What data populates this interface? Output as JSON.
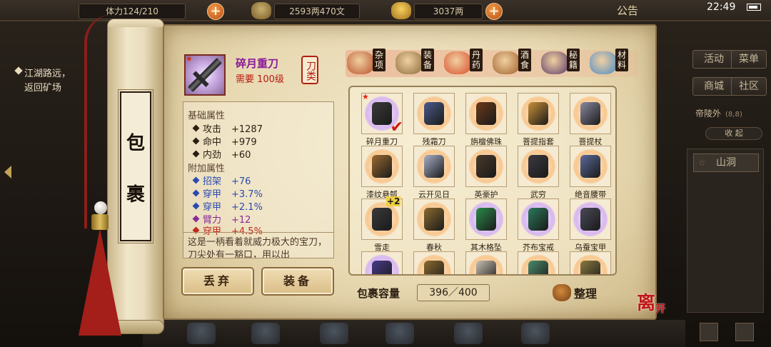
{
  "topbar": {
    "stamina": "体力124/210",
    "money": "2593两470文",
    "gold": "3037两",
    "notice": "公告",
    "clock": "22:49"
  },
  "quest": {
    "line1": "江湖路远，",
    "line2": "返回矿场"
  },
  "right_menu": {
    "activity": "活动",
    "menu": "菜单",
    "shop": "商城",
    "community": "社区",
    "location": "帝陵外",
    "location_coord": "(8,8)",
    "collapse": "收 起",
    "map_item": "山洞"
  },
  "scroll": {
    "title_char1": "包",
    "title_char2": "裹"
  },
  "item": {
    "name": "碎月重刀",
    "requirement": "需要 100级",
    "type_tag": "刀类",
    "base_section": "基础属性",
    "base_attrs": [
      {
        "name": "攻击",
        "value": "+1287"
      },
      {
        "name": "命中",
        "value": "+979"
      },
      {
        "name": "内劲",
        "value": "+60"
      }
    ],
    "extra_section": "附加属性",
    "extra_attrs": [
      {
        "name": "招架",
        "value": "+76"
      },
      {
        "name": "穿甲",
        "value": "+3.7%"
      },
      {
        "name": "穿甲",
        "value": "+2.1%"
      },
      {
        "name": "臂力",
        "value": "+12"
      },
      {
        "name": "穿甲",
        "value": "+4.5%"
      }
    ],
    "description": "这是一柄看着就威力极大的宝刀，刀尖处有一豁口，用以出"
  },
  "actions": {
    "discard": "丢弃",
    "equip": "装备"
  },
  "tabs": [
    {
      "label": "杂项",
      "icon": "pot-icon"
    },
    {
      "label": "装备",
      "icon": "weapon-bundle-icon"
    },
    {
      "label": "丹药",
      "icon": "pills-icon"
    },
    {
      "label": "酒食",
      "icon": "wine-food-icon"
    },
    {
      "label": "秘籍",
      "icon": "books-icon"
    },
    {
      "label": "材料",
      "icon": "crystal-icon"
    }
  ],
  "inventory": [
    {
      "label": "碎月重刀",
      "icon": "heavy-saber-icon",
      "glow": "#d8b8f0",
      "art": "#3a3a3a",
      "selected": true
    },
    {
      "label": "残霜刀",
      "icon": "frost-blade-icon",
      "glow": "#f8c890",
      "art": "#4a5a8a"
    },
    {
      "label": "旃檀佛珠",
      "icon": "prayer-beads-icon",
      "glow": "#f8c890",
      "art": "#6a3a18"
    },
    {
      "label": "菩提指套",
      "icon": "finger-guard-icon",
      "glow": "#f8c890",
      "art": "#c89038"
    },
    {
      "label": "菩提杖",
      "icon": "staff-icon",
      "glow": "#f8c890",
      "art": "#8a8aa0"
    },
    {
      "label": "漆纹悬瓠",
      "icon": "gourd-icon",
      "glow": "#f8c890",
      "art": "#9a6a30"
    },
    {
      "label": "云开见日",
      "icon": "armband-icon",
      "glow": "#f8c890",
      "art": "#a8b0c8"
    },
    {
      "label": "英豪护",
      "icon": "bracer-icon",
      "glow": "#f8c890",
      "art": "#4a3a2a"
    },
    {
      "label": "武穷",
      "icon": "gauntlet-icon",
      "glow": "#f8c890",
      "art": "#3a3a40"
    },
    {
      "label": "绝音腰带",
      "icon": "belt-icon",
      "glow": "#f8c890",
      "art": "#5a6a9a"
    },
    {
      "label": "雪走",
      "icon": "snow-blade-icon",
      "glow": "#f8c890",
      "art": "#3a3a3a",
      "badge": "+2"
    },
    {
      "label": "春秋",
      "icon": "spring-autumn-blade-icon",
      "glow": "#f8c890",
      "art": "#8a6a30"
    },
    {
      "label": "其木格坠",
      "icon": "jade-pendant-icon",
      "glow": "#d8b8f0",
      "art": "#2a8a4a"
    },
    {
      "label": "芥布宝戒",
      "icon": "jade-ring-icon",
      "glow": "#d8b8f0",
      "art": "#2a7a5a"
    },
    {
      "label": "乌蚕宝甲",
      "icon": "armor-icon",
      "glow": "#d8b8f0",
      "art": "#4a4a58"
    },
    {
      "label": "",
      "icon": "gloves-icon",
      "glow": "#d8b8f0",
      "art": "#4a3a8a"
    },
    {
      "label": "",
      "icon": "mace-icon",
      "glow": "#f8c890",
      "art": "#8a6a30"
    },
    {
      "label": "",
      "icon": "scroll-item-icon",
      "glow": "#f8c890",
      "art": "#c8c0b0"
    },
    {
      "label": "",
      "icon": "dragon-item-icon",
      "glow": "#f8c890",
      "art": "#4a8a6a"
    },
    {
      "label": "",
      "icon": "blade-item-icon",
      "glow": "#f8c890",
      "art": "#8a7a40"
    }
  ],
  "capacity": {
    "label": "包裹容量",
    "value": "396／400"
  },
  "sort": {
    "label": "整理"
  },
  "leave": {
    "label1": "离",
    "label2": "开"
  }
}
